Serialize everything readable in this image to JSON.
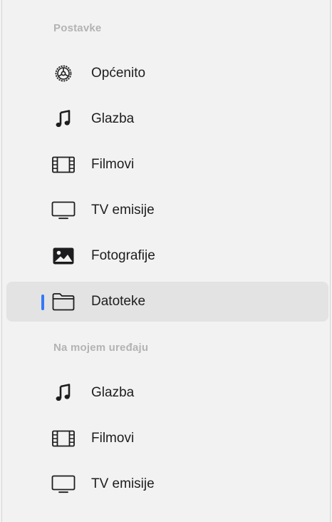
{
  "sidebar": {
    "sections": [
      {
        "header": "Postavke",
        "items": [
          {
            "label": "Općenito",
            "icon": "gear-icon",
            "selected": false
          },
          {
            "label": "Glazba",
            "icon": "music-note-icon",
            "selected": false
          },
          {
            "label": "Filmovi",
            "icon": "film-icon",
            "selected": false
          },
          {
            "label": "TV emisije",
            "icon": "tv-icon",
            "selected": false
          },
          {
            "label": "Fotografije",
            "icon": "photo-icon",
            "selected": false
          },
          {
            "label": "Datoteke",
            "icon": "folder-icon",
            "selected": true
          }
        ]
      },
      {
        "header": "Na mojem uređaju",
        "items": [
          {
            "label": "Glazba",
            "icon": "music-note-icon",
            "selected": false
          },
          {
            "label": "Filmovi",
            "icon": "film-icon",
            "selected": false
          },
          {
            "label": "TV emisije",
            "icon": "tv-icon",
            "selected": false
          }
        ]
      }
    ],
    "colors": {
      "background": "#f2f2f2",
      "selected_background": "#e3e3e3",
      "accent": "#3478f6",
      "header_text": "#b3b3b3",
      "item_text": "#1d1d1f"
    }
  }
}
